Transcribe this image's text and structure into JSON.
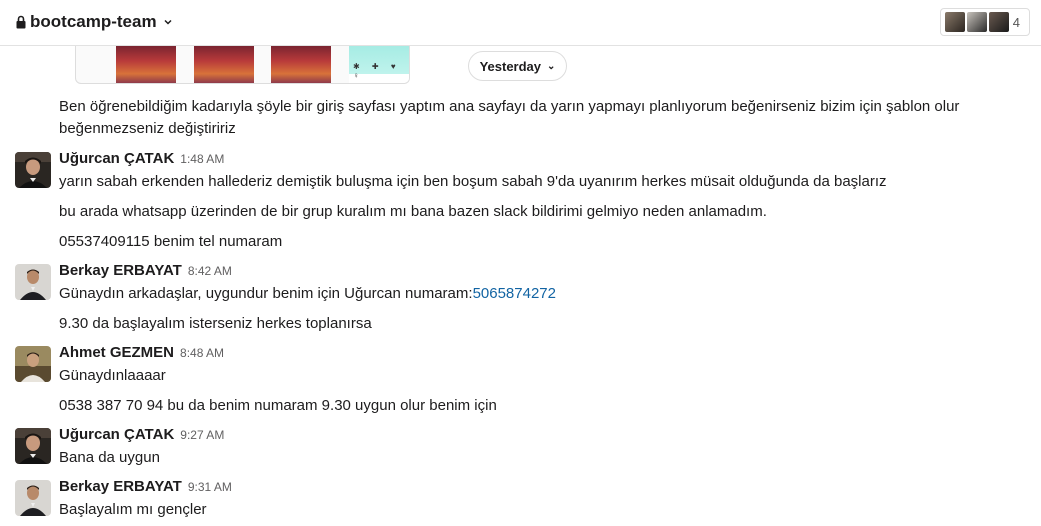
{
  "header": {
    "channel_name": "bootcamp-team",
    "member_count": "4",
    "icons": [
      "lock-icon",
      "chevron-down-icon"
    ]
  },
  "day_divider": {
    "label": "Yesterday"
  },
  "attachment": {
    "icons_text": "✱ ✚ ♥ ♀"
  },
  "intro_message": "Ben öğrenebildiğim kadarıyla şöyle bir giriş sayfası yaptım ana sayfayı da yarın yapmayı planlıyorum beğenirseniz bizim için şablon olur beğenmezseniz değiştiririz",
  "messages": [
    {
      "author": "Uğurcan ÇATAK",
      "time": "1:48 AM",
      "lines": [
        "yarın sabah erkenden hallederiz demiştik buluşma için ben boşum sabah 9'da uyanırım herkes müsait olduğunda da başlarız",
        "bu arada whatsapp üzerinden de bir grup kuralım mı bana bazen slack bildirimi gelmiyo neden anlamadım.",
        "05537409115 benim tel numaram"
      ]
    },
    {
      "author": "Berkay ERBAYAT",
      "time": "8:42 AM",
      "line1_prefix": "Günaydın arkadaşlar, uygundur benim için Uğurcan numaram:",
      "line1_link": "5065874272",
      "lines": [
        "9.30 da başlayalım isterseniz herkes toplanırsa"
      ]
    },
    {
      "author": "Ahmet GEZMEN",
      "time": "8:48 AM",
      "lines": [
        "Günaydınlaaaar",
        "0538 387 70 94 bu da benim numaram 9.30 uygun olur benim için"
      ]
    },
    {
      "author": "Uğurcan ÇATAK",
      "time": "9:27 AM",
      "lines": [
        "Bana da uygun"
      ]
    },
    {
      "author": "Berkay ERBAYAT",
      "time": "9:31 AM",
      "lines": [
        "Başlayalım mı gençler"
      ]
    }
  ],
  "colors": {
    "link": "#1264a3",
    "timestamp": "#616061"
  }
}
